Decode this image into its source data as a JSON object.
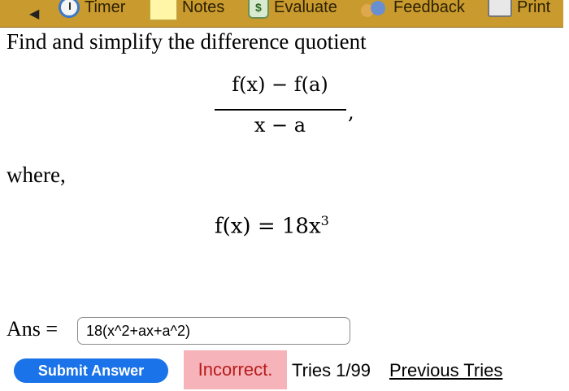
{
  "toolbar": {
    "back_glyph": "◀",
    "timer_label": "Timer",
    "notes_label": "Notes",
    "evaluate_label": "Evaluate",
    "feedback_label": "Feedback",
    "print_label": "Print",
    "icons": [
      "timer-icon",
      "notes-icon",
      "evaluate-icon",
      "feedback-icon",
      "print-icon"
    ],
    "bg_color": "#c99a2e"
  },
  "problem": {
    "intro": "Find and simplify the difference quotient",
    "numerator": "f(x) − f(a)",
    "denominator": "x − a",
    "comma": ",",
    "where": "where,",
    "function_lhs": "f(x) = 18x",
    "function_exp": "3"
  },
  "answer": {
    "label": "Ans =",
    "value": "18(x^2+ax+a^2)"
  },
  "actions": {
    "submit_label": "Submit Answer",
    "status_text": "Incorrect.",
    "tries_text": "Tries 1/99",
    "previous_tries_label": "Previous Tries"
  },
  "colors": {
    "submit_bg": "#1a73e8",
    "incorrect_bg": "#f6b3b9",
    "incorrect_text": "#b71c1c"
  }
}
